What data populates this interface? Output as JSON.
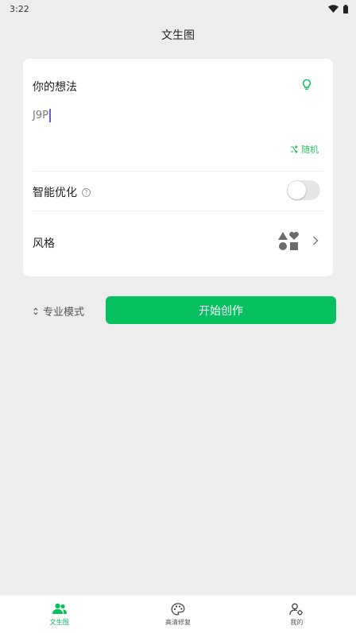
{
  "status_bar": {
    "time": "3:22"
  },
  "page": {
    "title": "文生图"
  },
  "idea": {
    "label": "你的想法",
    "input_value": "J9P",
    "random_label": "随机"
  },
  "smart_optimize": {
    "label": "智能优化",
    "enabled": false
  },
  "style": {
    "label": "风格"
  },
  "actions": {
    "pro_mode_label": "专业模式",
    "start_label": "开始创作"
  },
  "tabs": [
    {
      "label": "文生图",
      "icon": "people-icon",
      "active": true
    },
    {
      "label": "高清修复",
      "icon": "palette-icon",
      "active": false
    },
    {
      "label": "我的",
      "icon": "user-settings-icon",
      "active": false
    }
  ],
  "colors": {
    "accent": "#07C160",
    "accent_text": "#2DBE60",
    "background": "#EDEDED",
    "caret": "#6B5AE0"
  }
}
